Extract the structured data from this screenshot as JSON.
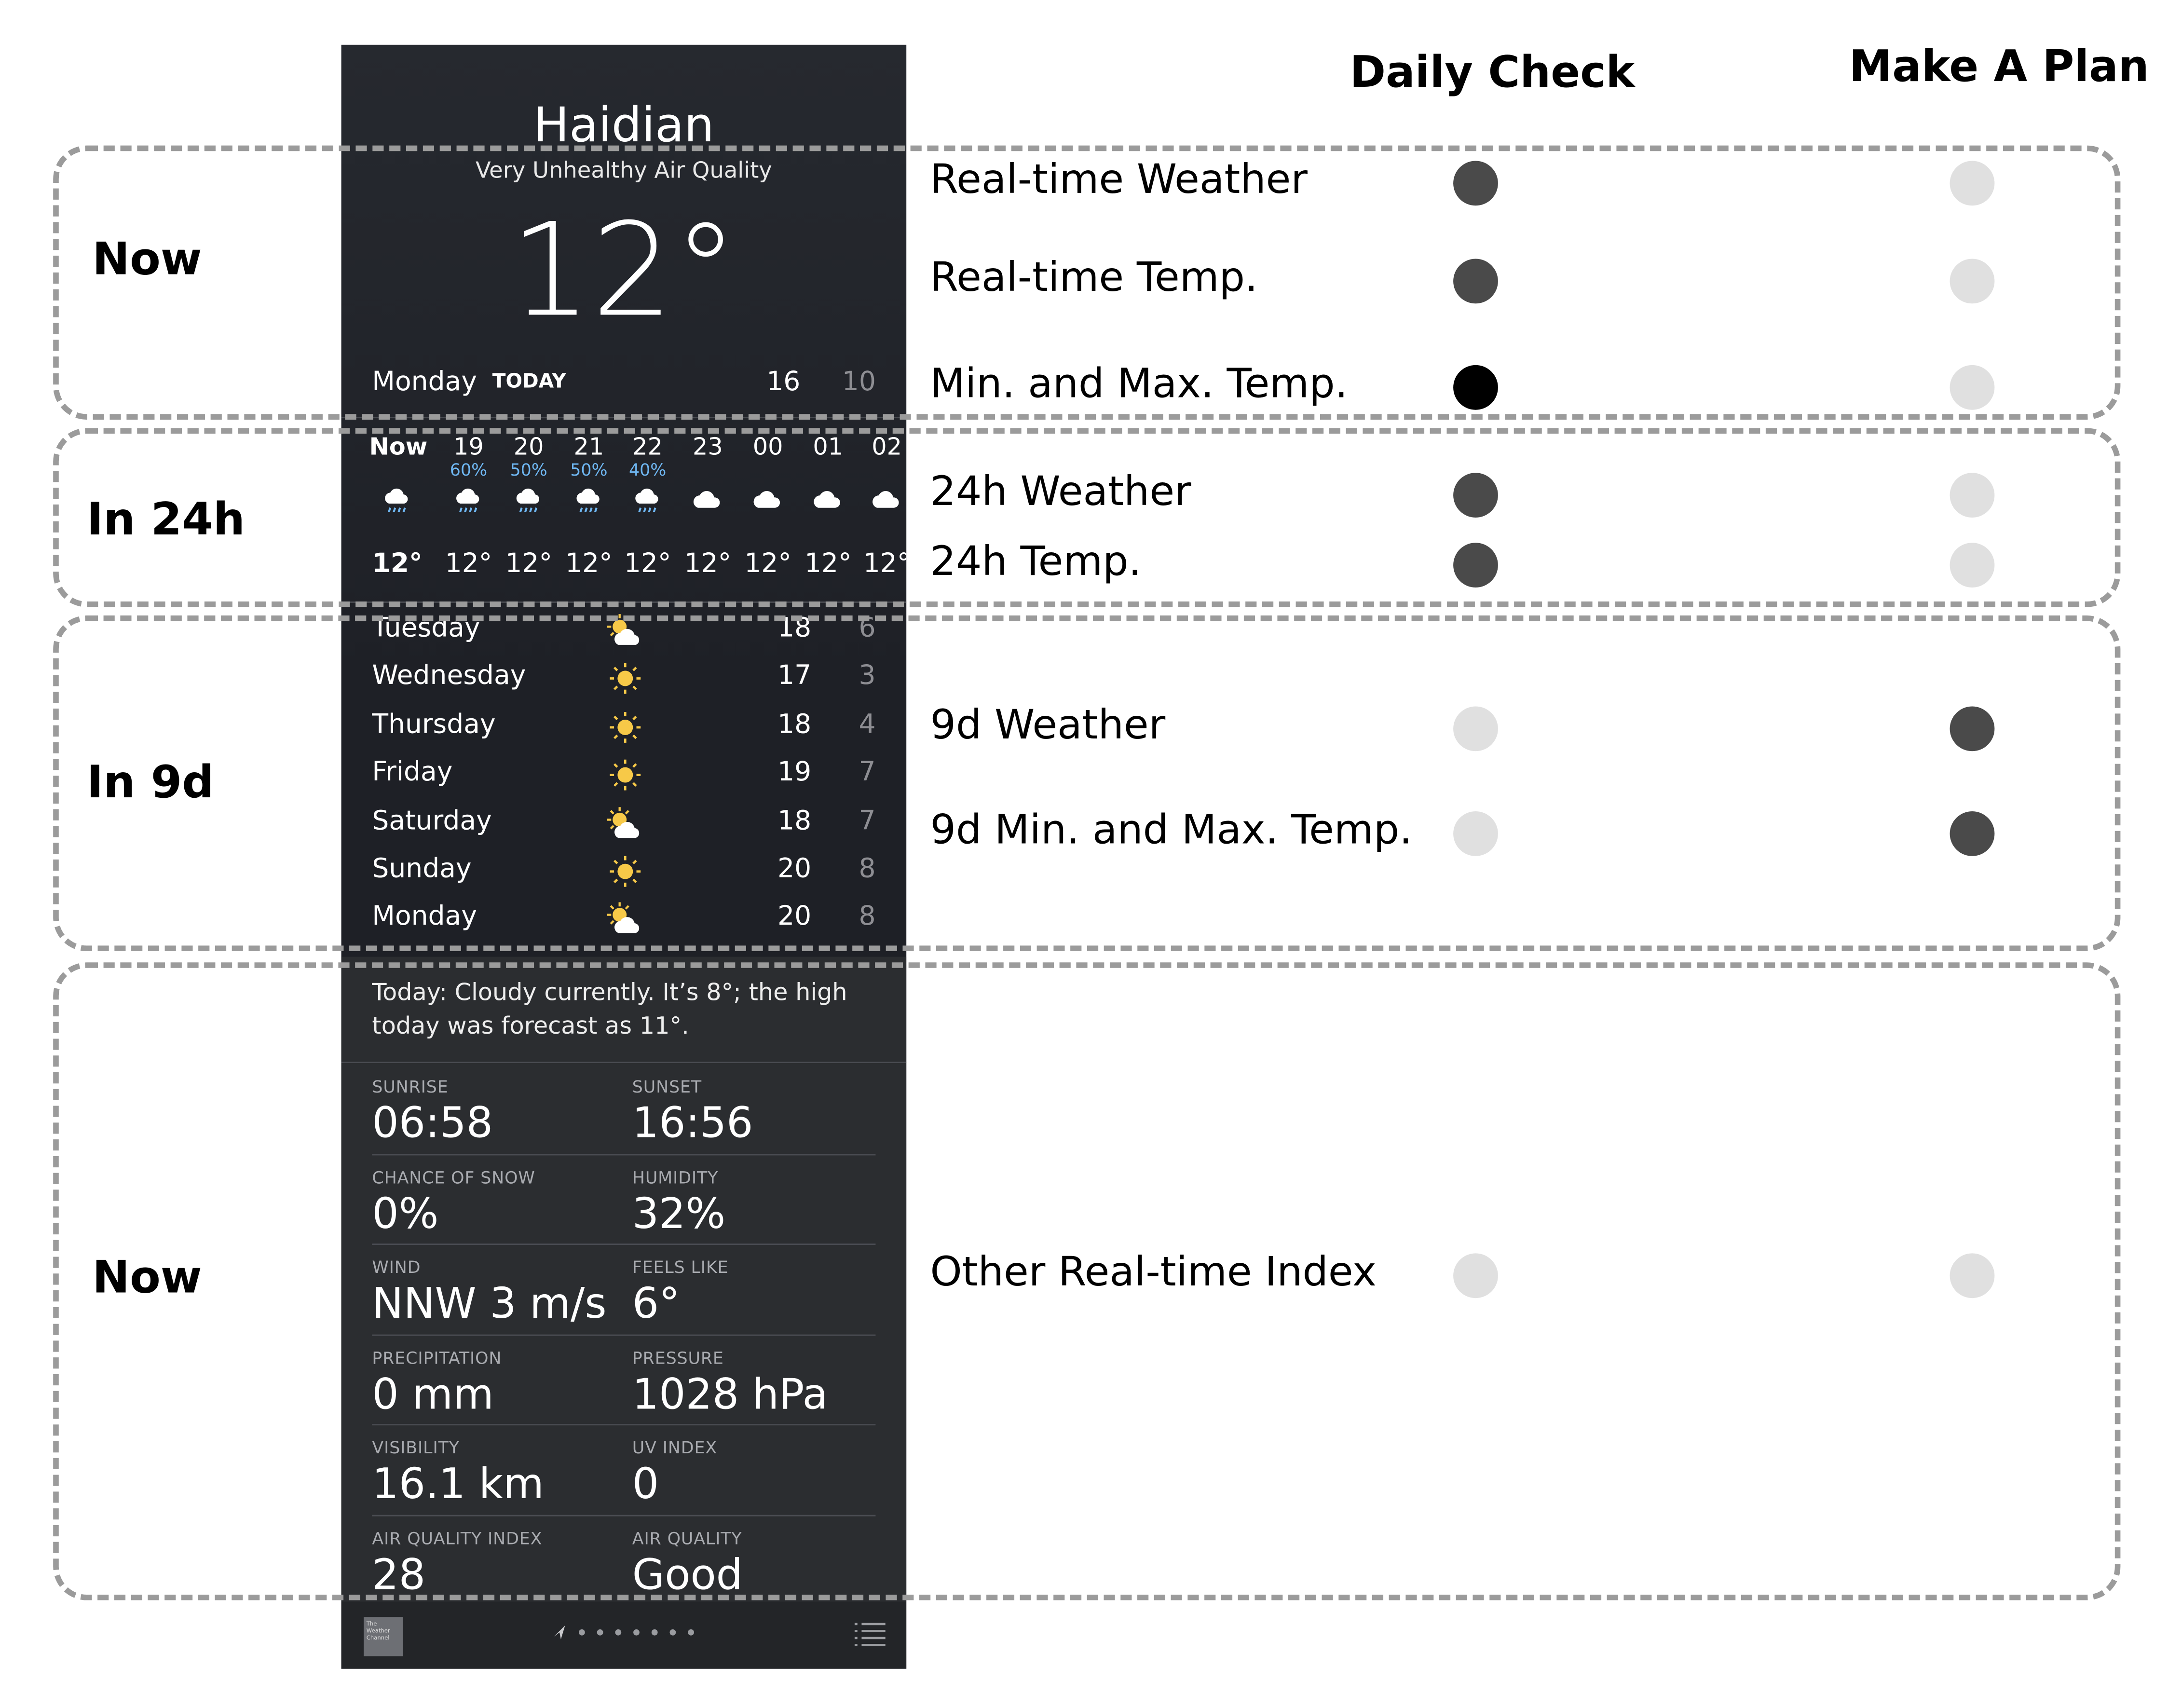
{
  "columns": {
    "daily_check": "Daily Check",
    "make_a_plan": "Make A Plan"
  },
  "colors": {
    "dot_dark": "#4a4a4a",
    "dot_black": "#000000",
    "dot_light": "#e0e0e0",
    "frame": "#9b9b9b",
    "precip_blue": "#6fb7f2",
    "sun_yellow": "#f7c948"
  },
  "groups": [
    {
      "label": "Now",
      "rows": [
        {
          "label": "Real-time Weather",
          "daily": "dark",
          "plan": "light"
        },
        {
          "label": "Real-time Temp.",
          "daily": "dark",
          "plan": "light"
        },
        {
          "label": "Min. and Max. Temp.",
          "daily": "black",
          "plan": "light"
        }
      ]
    },
    {
      "label": "In 24h",
      "rows": [
        {
          "label": "24h Weather",
          "daily": "dark",
          "plan": "light"
        },
        {
          "label": "24h Temp.",
          "daily": "dark",
          "plan": "light"
        }
      ]
    },
    {
      "label": "In 9d",
      "rows": [
        {
          "label": "9d Weather",
          "daily": "light",
          "plan": "dark"
        },
        {
          "label": "9d Min. and Max. Temp.",
          "daily": "light",
          "plan": "dark"
        }
      ]
    },
    {
      "label": "Now",
      "rows": [
        {
          "label": "Other Real-time Index",
          "daily": "light",
          "plan": "light"
        }
      ]
    }
  ],
  "phone": {
    "city": "Haidian",
    "air_quality": "Very Unhealthy Air Quality",
    "current_temp": "12°",
    "today": {
      "day": "Monday",
      "tag": "TODAY",
      "high": "16",
      "low": "10"
    },
    "hourly": [
      {
        "hour": "Now",
        "precip": "",
        "icon": "rain-cloud-icon",
        "temp": "12°"
      },
      {
        "hour": "19",
        "precip": "60%",
        "icon": "rain-cloud-icon",
        "temp": "12°"
      },
      {
        "hour": "20",
        "precip": "50%",
        "icon": "rain-cloud-icon",
        "temp": "12°"
      },
      {
        "hour": "21",
        "precip": "50%",
        "icon": "rain-cloud-icon",
        "temp": "12°"
      },
      {
        "hour": "22",
        "precip": "40%",
        "icon": "rain-cloud-icon",
        "temp": "12°"
      },
      {
        "hour": "23",
        "precip": "",
        "icon": "cloud-icon",
        "temp": "12°"
      },
      {
        "hour": "00",
        "precip": "",
        "icon": "cloud-icon",
        "temp": "12°"
      },
      {
        "hour": "01",
        "precip": "",
        "icon": "cloud-icon",
        "temp": "12°"
      },
      {
        "hour": "02",
        "precip": "",
        "icon": "cloud-icon",
        "temp": "12°"
      }
    ],
    "daily": [
      {
        "day": "Tuesday",
        "icon": "partly-cloudy-icon",
        "high": "18",
        "low": "6"
      },
      {
        "day": "Wednesday",
        "icon": "sun-icon",
        "high": "17",
        "low": "3"
      },
      {
        "day": "Thursday",
        "icon": "sun-icon",
        "high": "18",
        "low": "4"
      },
      {
        "day": "Friday",
        "icon": "sun-icon",
        "high": "19",
        "low": "7"
      },
      {
        "day": "Saturday",
        "icon": "partly-cloudy-icon",
        "high": "18",
        "low": "7"
      },
      {
        "day": "Sunday",
        "icon": "sun-icon",
        "high": "20",
        "low": "8"
      },
      {
        "day": "Monday",
        "icon": "partly-cloudy-icon",
        "high": "20",
        "low": "8"
      }
    ],
    "summary": "Today: Cloudy currently. It’s 8°; the high today was forecast as 11°.",
    "details": [
      {
        "label": "SUNRISE",
        "value": "06:58"
      },
      {
        "label": "SUNSET",
        "value": "16:56"
      },
      {
        "label": "CHANCE OF SNOW",
        "value": "0%"
      },
      {
        "label": "HUMIDITY",
        "value": "32%"
      },
      {
        "label": "WIND",
        "value": "NNW 3 m/s"
      },
      {
        "label": "FEELS LIKE",
        "value": "6°"
      },
      {
        "label": "PRECIPITATION",
        "value": "0 mm"
      },
      {
        "label": "PRESSURE",
        "value": "1028 hPa"
      },
      {
        "label": "VISIBILITY",
        "value": "16.1 km"
      },
      {
        "label": "UV INDEX",
        "value": "0"
      },
      {
        "label": "AIR QUALITY INDEX",
        "value": "28"
      },
      {
        "label": "AIR QUALITY",
        "value": "Good"
      }
    ],
    "logo_text": "The Weather Channel"
  }
}
